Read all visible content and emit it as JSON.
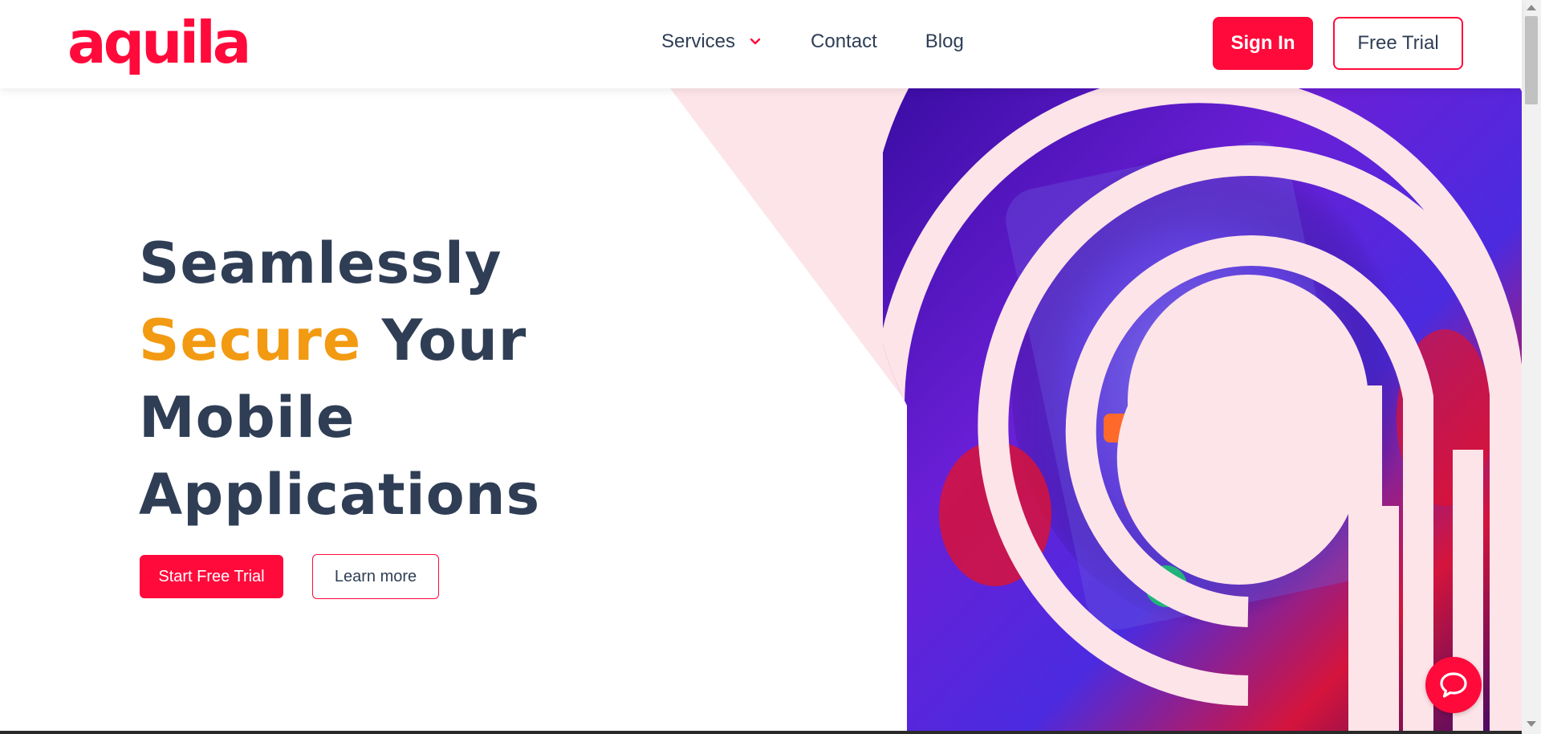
{
  "brand": {
    "logo_text": "aquila",
    "accent": "#ff0a3b",
    "highlight": "#f29a12",
    "text_color": "#2f3e55"
  },
  "nav": {
    "items": [
      {
        "label": "Services",
        "has_dropdown": true
      },
      {
        "label": "Contact"
      },
      {
        "label": "Blog"
      }
    ],
    "sign_in": "Sign In",
    "free_trial": "Free Trial"
  },
  "hero": {
    "line1": "Seamlessly",
    "line2_accent": "Secure",
    "line2_rest": " Your",
    "line3": "Mobile",
    "line4": "Applications",
    "primary_cta": "Start Free Trial",
    "secondary_cta": "Learn more"
  },
  "icons": {
    "chat": "chat-bubble-icon",
    "dropdown": "chevron-down-icon"
  }
}
